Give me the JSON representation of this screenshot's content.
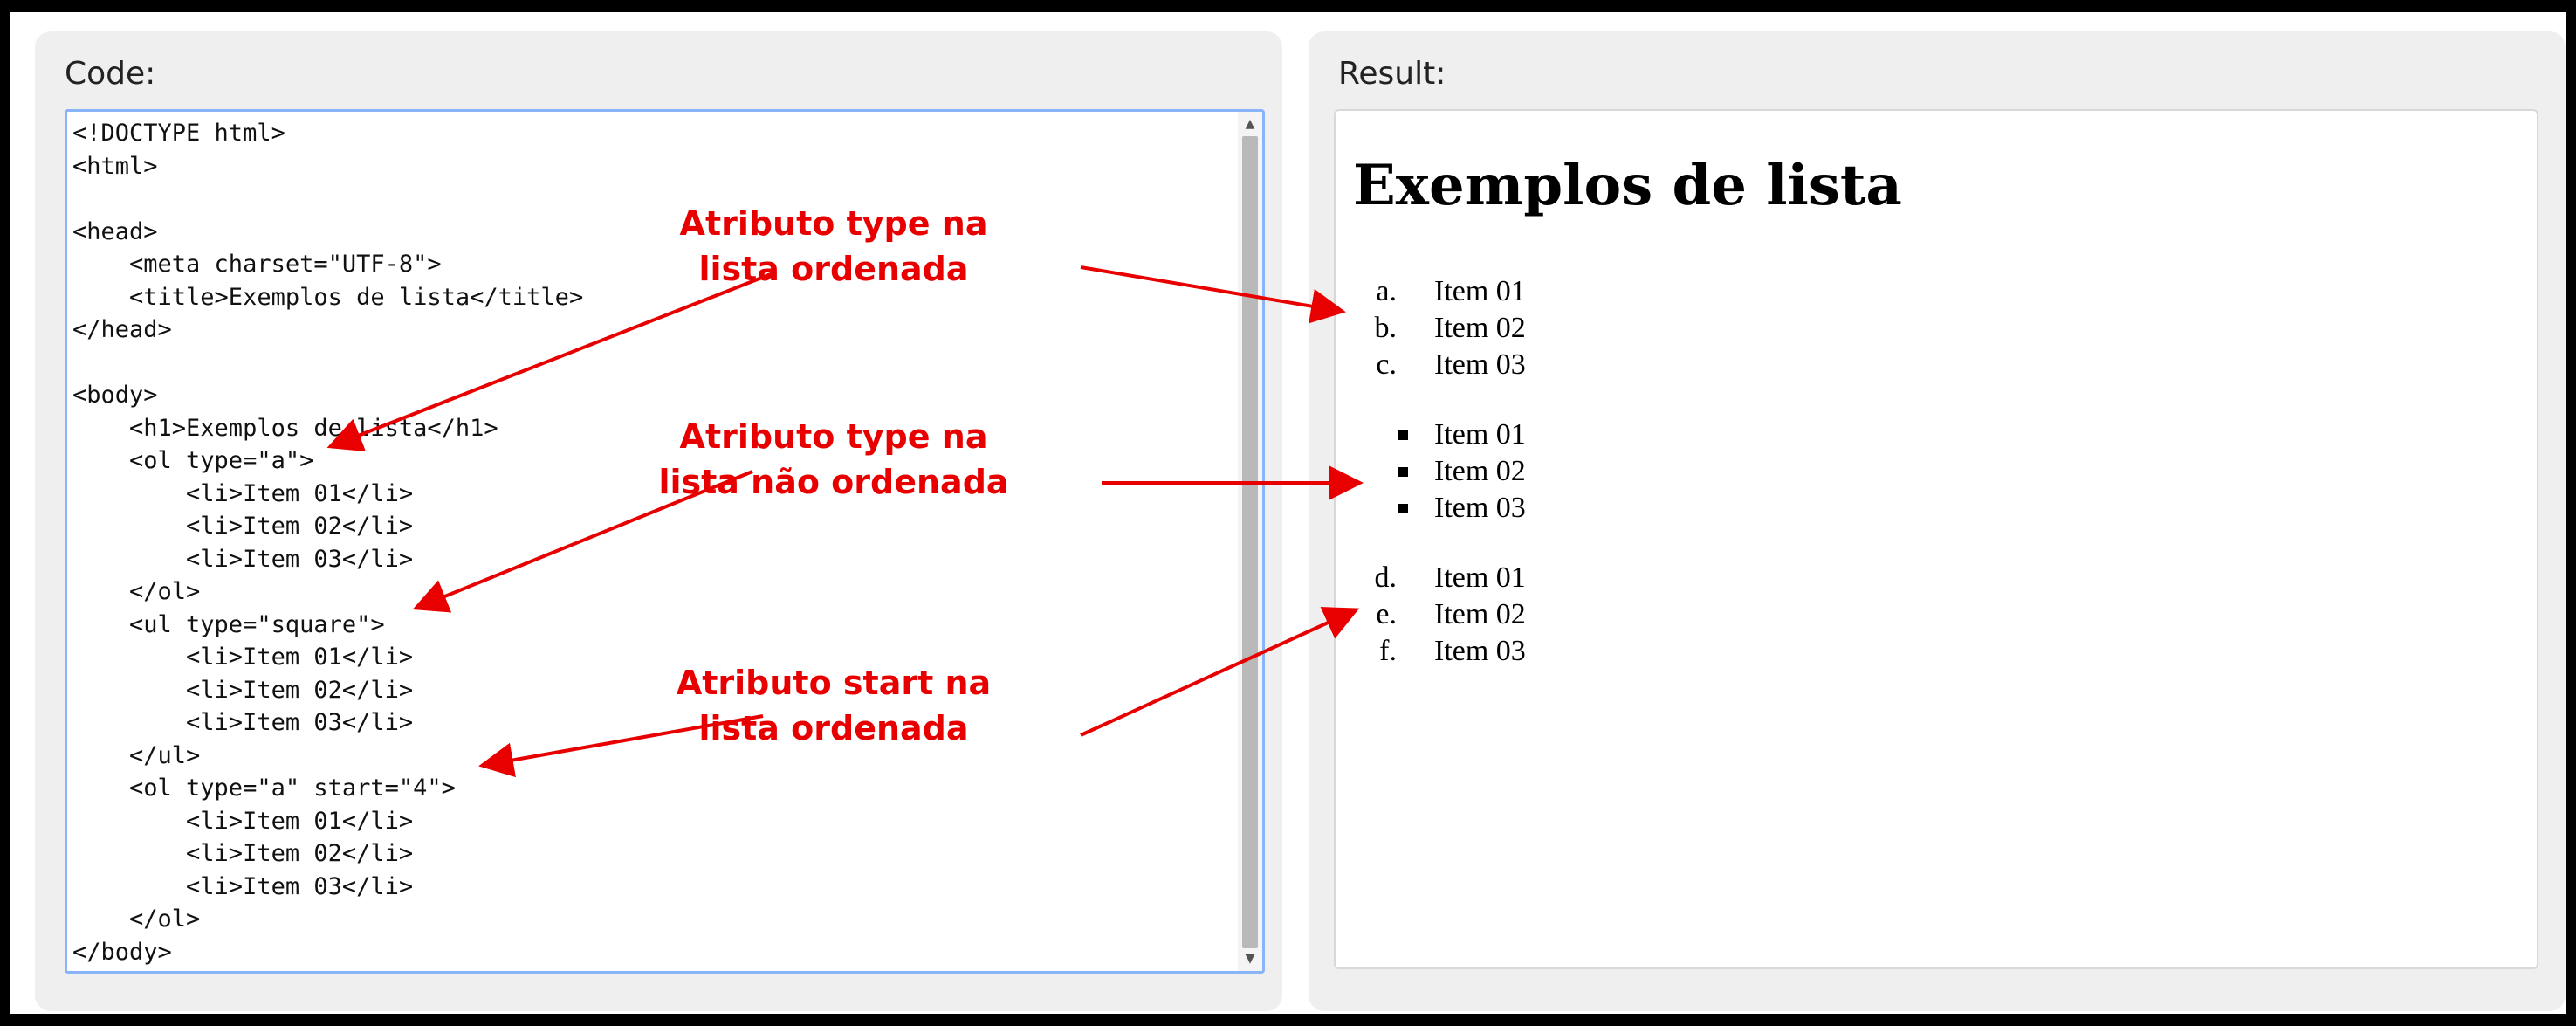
{
  "code_panel": {
    "title": "Code:",
    "lines": [
      "<!DOCTYPE html>",
      "<html>",
      "",
      "<head>",
      "    <meta charset=\"UTF-8\">",
      "    <title>Exemplos de lista</title>",
      "</head>",
      "",
      "<body>",
      "    <h1>Exemplos de lista</h1>",
      "    <ol type=\"a\">",
      "        <li>Item 01</li>",
      "        <li>Item 02</li>",
      "        <li>Item 03</li>",
      "    </ol>",
      "    <ul type=\"square\">",
      "        <li>Item 01</li>",
      "        <li>Item 02</li>",
      "        <li>Item 03</li>",
      "    </ul>",
      "    <ol type=\"a\" start=\"4\">",
      "        <li>Item 01</li>",
      "        <li>Item 02</li>",
      "        <li>Item 03</li>",
      "    </ol>",
      "</body>"
    ]
  },
  "result_panel": {
    "title": "Result:",
    "heading": "Exemplos de lista",
    "ordered_list": [
      {
        "marker": "a.",
        "text": "Item 01"
      },
      {
        "marker": "b.",
        "text": "Item 02"
      },
      {
        "marker": "c.",
        "text": "Item 03"
      }
    ],
    "square_list": [
      {
        "text": "Item 01"
      },
      {
        "text": "Item 02"
      },
      {
        "text": "Item 03"
      }
    ],
    "started_list": [
      {
        "marker": "d.",
        "text": "Item 01"
      },
      {
        "marker": "e.",
        "text": "Item 02"
      },
      {
        "marker": "f.",
        "text": "Item 03"
      }
    ]
  },
  "annotations": {
    "type_ordered": {
      "line1": "Atributo type na",
      "line2": "lista ordenada"
    },
    "type_unordered": {
      "line1": "Atributo type na",
      "line2": "lista não ordenada"
    },
    "start_ordered": {
      "line1": "Atributo start na",
      "line2": "lista ordenada"
    },
    "color": "#e80000"
  },
  "colors": {
    "panel_background": "#efefef",
    "code_border": "#8ab4f8",
    "outer_border": "#000000"
  }
}
